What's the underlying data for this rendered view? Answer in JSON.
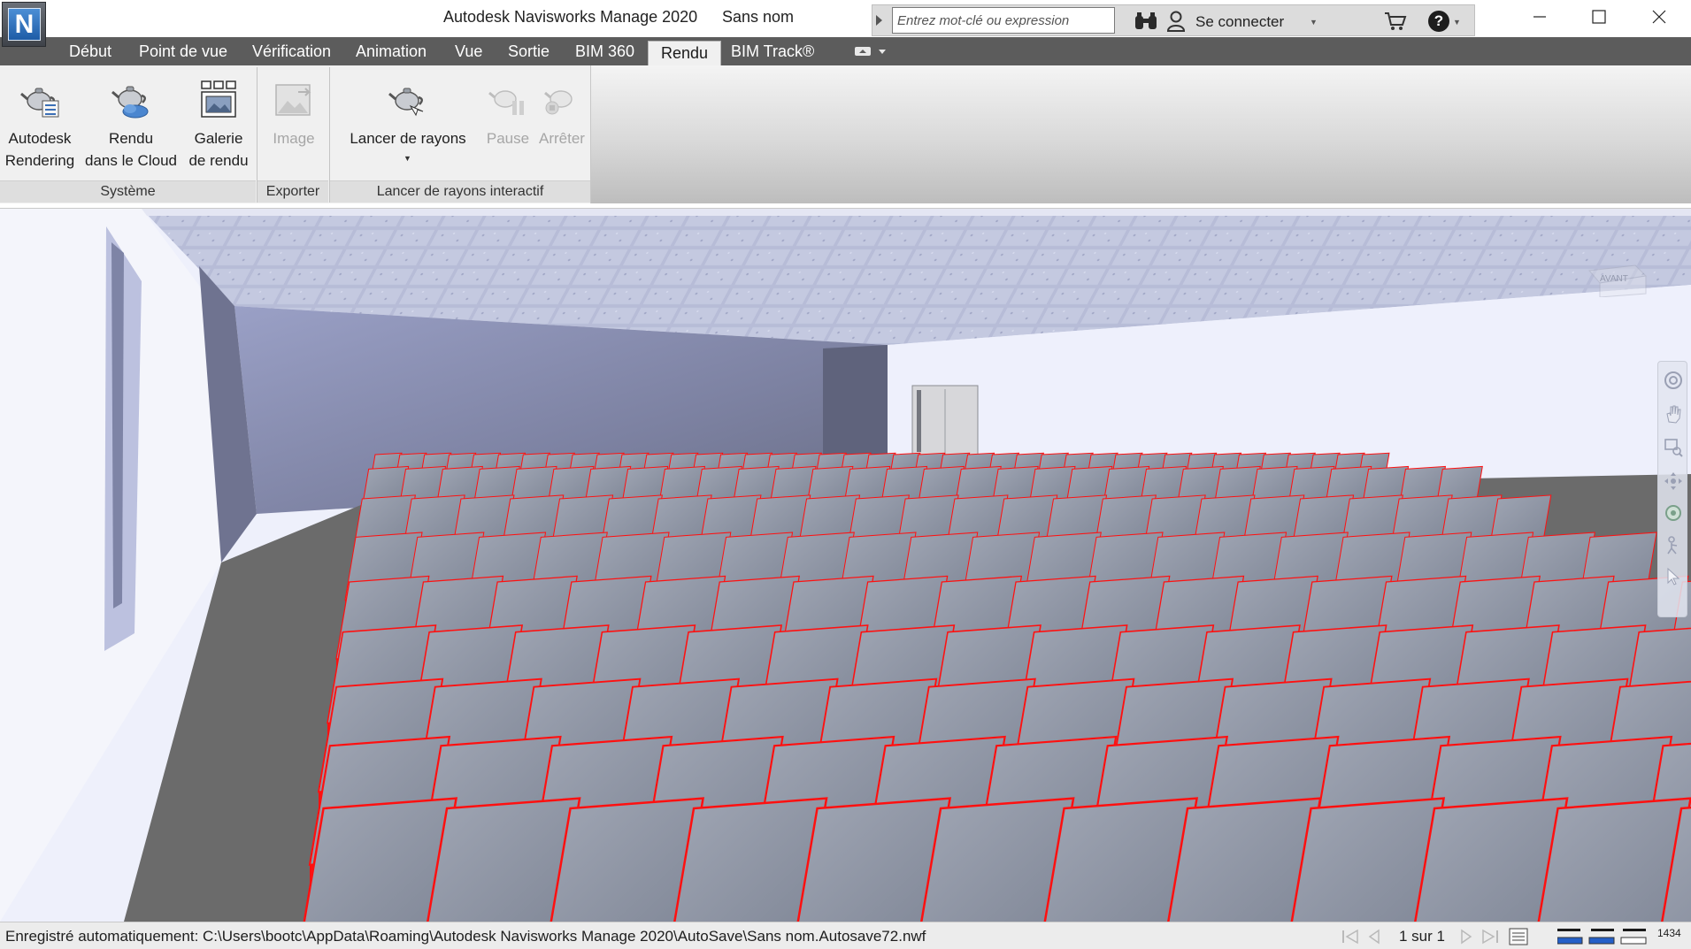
{
  "app": {
    "title": "Autodesk Navisworks Manage 2020",
    "document": "Sans nom",
    "logo_letter": "N"
  },
  "infocenter": {
    "search_placeholder": "Entrez mot-clé ou expression",
    "signin_label": "Se connecter"
  },
  "tabs": [
    {
      "label": "Début"
    },
    {
      "label": "Point de vue"
    },
    {
      "label": "Vérification"
    },
    {
      "label": "Animation"
    },
    {
      "label": "Vue"
    },
    {
      "label": "Sortie"
    },
    {
      "label": "BIM 360"
    },
    {
      "label": "Rendu",
      "active": true
    },
    {
      "label": "BIM Track®"
    }
  ],
  "ribbon": {
    "panels": [
      {
        "title": "Système",
        "buttons": [
          {
            "line1": "Autodesk",
            "line2": "Rendering",
            "icon": "teapot-rendering-icon",
            "enabled": true
          },
          {
            "line1": "Rendu",
            "line2": "dans le Cloud",
            "icon": "teapot-cloud-icon",
            "enabled": true
          },
          {
            "line1": "Galerie",
            "line2": "de rendu",
            "icon": "gallery-icon",
            "enabled": true
          }
        ]
      },
      {
        "title": "Exporter",
        "buttons": [
          {
            "line1": "Image",
            "icon": "image-export-icon",
            "enabled": false
          }
        ]
      },
      {
        "title": "Lancer de rayons interactif",
        "buttons": [
          {
            "line1": "Lancer de rayons",
            "icon": "teapot-raytrace-icon",
            "enabled": true,
            "has_dropdown": true
          },
          {
            "line1": "Pause",
            "icon": "pause-teapot-icon",
            "enabled": false
          },
          {
            "line1": "Arrêter",
            "icon": "stop-teapot-icon",
            "enabled": false
          }
        ]
      }
    ]
  },
  "viewport": {
    "viewcube_label": "AVANT",
    "scene": "auditorium"
  },
  "status": {
    "message": "Enregistré automatiquement: C:\\Users\\bootc\\AppData\\Roaming\\Autodesk Navisworks Manage 2020\\AutoSave\\Sans nom.Autosave72.nwf",
    "page": "1 sur 1",
    "memory": "1434"
  },
  "colors": {
    "tabbar": "#5c5c5c",
    "seat_back": "#8f96a6",
    "seat_red": "#ff1010",
    "floor": "#6b6b6b",
    "back_wall": "#8085a8",
    "ceiling": "#b9bed8"
  }
}
